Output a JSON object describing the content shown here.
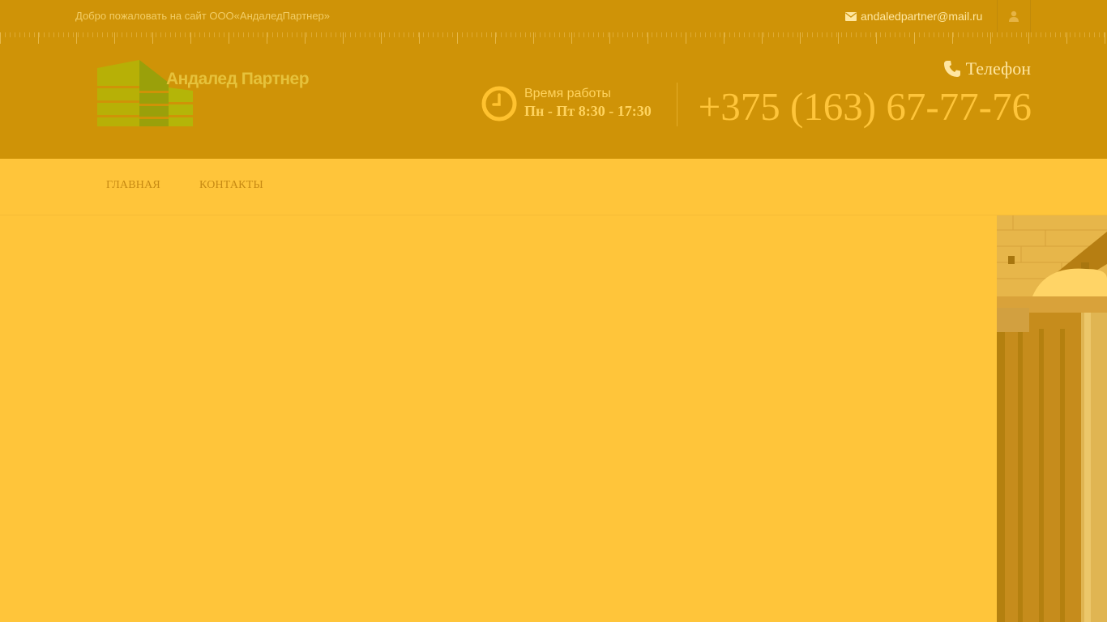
{
  "topbar": {
    "welcome": "Добро пожаловать на сайт ООО«АндаледПартнер»",
    "email": "andaledpartner@mail.ru",
    "email_icon": "envelope-icon",
    "user_icon": "user-icon"
  },
  "header": {
    "logo_text": "Андалед Партнер",
    "hours_label": "Время работы",
    "hours_value": "Пн - Пт 8:30 - 17:30",
    "phone_label": "Телефон",
    "phone_number": "+375 (163) 67-77-76",
    "clock_icon": "clock-icon",
    "phone_icon": "phone-icon"
  },
  "nav": {
    "items": [
      {
        "label": "ГЛАВНАЯ"
      },
      {
        "label": "КОНТАКТЫ"
      }
    ]
  },
  "colors": {
    "overlay": "#ffc53a",
    "topbar": "#cf9307",
    "accent": "#ffd35e"
  }
}
